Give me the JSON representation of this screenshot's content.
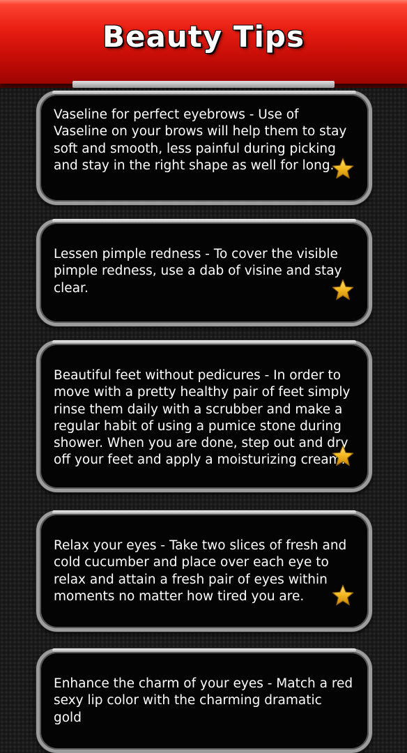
{
  "header": {
    "title": "Beauty Tips"
  },
  "colors": {
    "header_red": "#e81e12",
    "card_background": "#040404",
    "card_border": "#9c9c9c",
    "star_gold": "#f2b822"
  },
  "tips": [
    {
      "text": "Vaseline for perfect eyebrows - Use of Vaseline on your brows will help them to stay soft and smooth, less painful during picking and stay in the right shape as well for long.",
      "icon": "star-icon"
    },
    {
      "text": "Lessen pimple redness - To cover the visible pimple redness, use a dab of visine and stay clear.",
      "icon": "star-icon"
    },
    {
      "text": "Beautiful feet without pedicures - In order to move with a pretty healthy pair of feet simply rinse them daily with a scrubber and make a regular habit of using a pumice stone during shower. When you are done, step out and dry off your feet and apply a moisturizing cream.",
      "icon": "star-icon"
    },
    {
      "text": "Relax your eyes - Take two slices of fresh and cold cucumber and place over each eye to relax and attain a fresh pair of eyes within moments no matter how tired you are.",
      "icon": "star-icon"
    },
    {
      "text": "Enhance the charm of your eyes - Match a red sexy lip color with the charming dramatic gold",
      "icon": "star-icon"
    }
  ]
}
